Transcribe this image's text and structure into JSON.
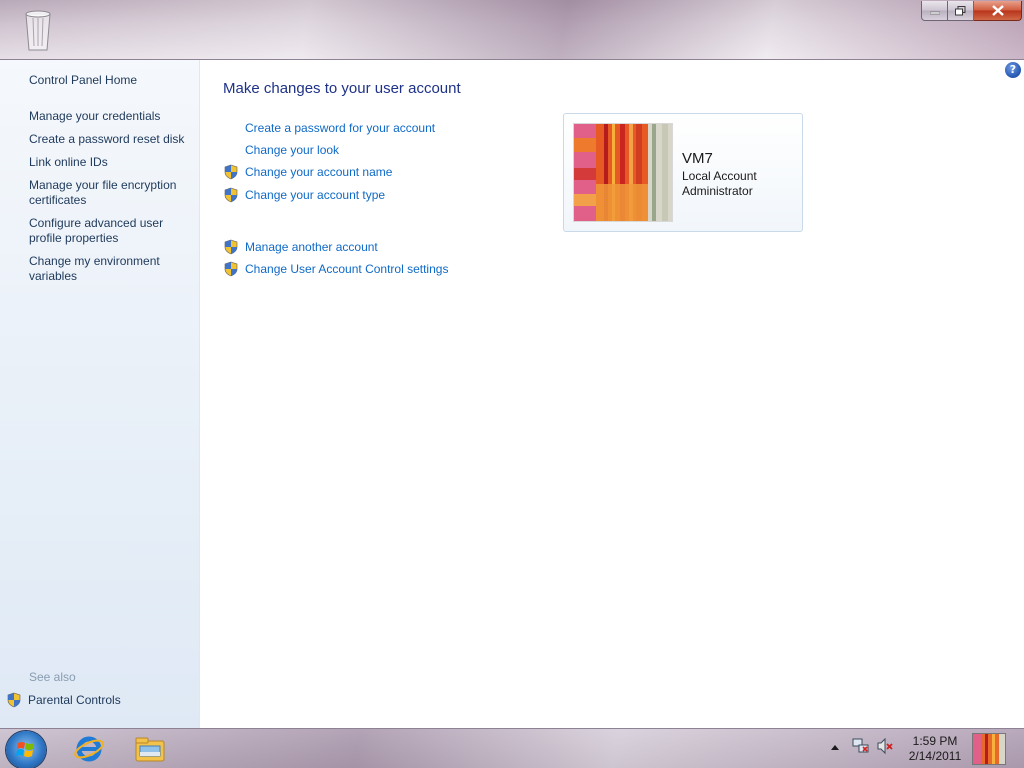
{
  "window": {
    "caption_buttons": [
      "minimize-icon",
      "maximize-icon",
      "close-icon"
    ]
  },
  "left_pane": {
    "home": "Control Panel Home",
    "items": [
      "Manage your credentials",
      "Create a password reset disk",
      "Link online IDs",
      "Manage your file encryption certificates",
      "Configure advanced user profile properties",
      "Change my environment variables"
    ],
    "see_also_label": "See also",
    "parental_controls": "Parental Controls"
  },
  "main": {
    "help_label": "?",
    "heading": "Make changes to your user account",
    "tasks": [
      {
        "label": "Create a password for your account",
        "shield": false
      },
      {
        "label": "Change your look",
        "shield": false
      },
      {
        "label": "Change your account name",
        "shield": true
      },
      {
        "label": "Change your account type",
        "shield": true
      }
    ],
    "tasks2": [
      {
        "label": "Manage another account",
        "shield": true
      },
      {
        "label": "Change User Account Control settings",
        "shield": true
      }
    ],
    "account": {
      "name": "VM7",
      "type": "Local Account",
      "role": "Administrator"
    }
  },
  "taskbar": {
    "pinned": [
      "start-orb-icon",
      "internet-explorer-icon",
      "windows-explorer-icon"
    ],
    "tray_icons": [
      "show-hidden-icons-arrow",
      "network-icon",
      "volume-muted-icon"
    ],
    "time": "1:59 PM",
    "date": "2/14/2011"
  },
  "colors": {
    "link": "#0f6ac7",
    "heading": "#1e3287",
    "nav_text": "#1e395b"
  }
}
